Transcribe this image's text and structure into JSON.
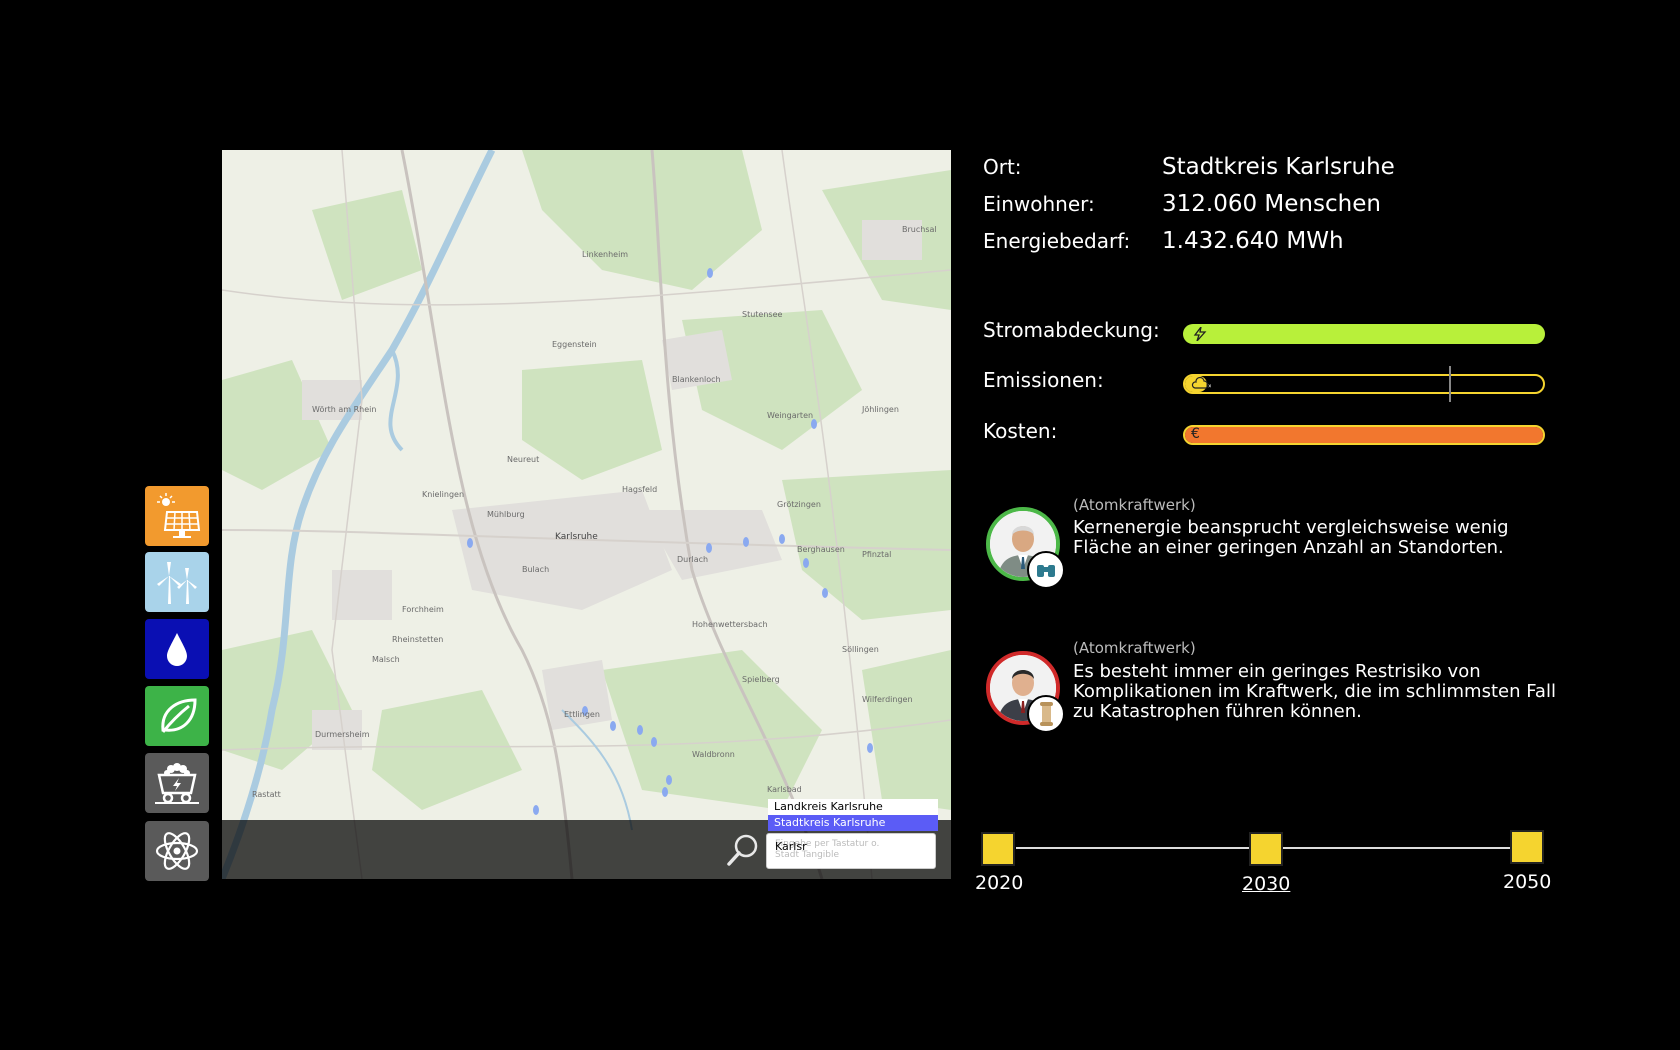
{
  "sidebar": {
    "items": [
      {
        "name": "solar",
        "icon": "solar-panel-icon",
        "color": "#f29a2e"
      },
      {
        "name": "wind",
        "icon": "wind-turbine-icon",
        "color": "#a9d3ea"
      },
      {
        "name": "water",
        "icon": "water-drop-icon",
        "color": "#0a0fb3"
      },
      {
        "name": "biomass",
        "icon": "leaf-icon",
        "color": "#3db348"
      },
      {
        "name": "coal",
        "icon": "coal-cart-icon",
        "color": "#5a5a5a"
      },
      {
        "name": "nuclear",
        "icon": "atom-icon",
        "color": "#5a5a5a"
      }
    ]
  },
  "map": {
    "labels": [
      "Karlsruhe",
      "Blankenloch",
      "Weingarten",
      "Ettlingen",
      "Durmersheim",
      "Rheinstetten",
      "Forchheim",
      "Bruchsal",
      "Linkenheim",
      "Stutensee",
      "Wörth am Rhein",
      "Durlach",
      "Grötzingen",
      "Berghausen",
      "Spielberg",
      "Malsch",
      "Rastatt",
      "Hagsfeld",
      "Eggenstein",
      "Neureut",
      "Bulach",
      "Mühlburg",
      "Knielingen",
      "Waldbronn",
      "Karlsbad",
      "Pfinztal",
      "Söllingen",
      "Jöhlingen",
      "Wilferdingen",
      "Hohenwettersbach"
    ]
  },
  "search": {
    "options": [
      "Landkreis Karlsruhe",
      "Stadtkreis Karlsruhe"
    ],
    "selected_index": 1,
    "value": "Karlsr",
    "hint_line1": "Eingabe per Tastatur o.",
    "hint_line2": "Stadt Tangible"
  },
  "info": {
    "ort_label": "Ort:",
    "ort_value": "Stadtkreis Karlsruhe",
    "einwohner_label": "Einwohner:",
    "einwohner_value": "312.060 Menschen",
    "energie_label": "Energiebedarf:",
    "energie_value": "1.432.640 MWh"
  },
  "bars": {
    "strom_label": "Stromabdeckung:",
    "strom_fill": 1.0,
    "strom_color": "#b8f03a",
    "strom_icon": "lightning-icon",
    "emission_label": "Emissionen:",
    "emission_fill": 0.06,
    "emission_marker": 0.73,
    "emission_color": "#f5d42f",
    "emission_icon": "cloud-icon",
    "kosten_label": "Kosten:",
    "kosten_fill": 1.0,
    "kosten_color": "#f2772e",
    "kosten_icon": "€"
  },
  "quotes": [
    {
      "source": "(Atomkraftwerk)",
      "text": "Kernenergie beansprucht vergleichsweise wenig Fläche an einer geringen Anzahl an Standorten.",
      "ring": "#4cb848"
    },
    {
      "source": "(Atomkraftwerk)",
      "text": "Es besteht immer ein geringes Restrisiko von Komplikationen im Kraftwerk, die im schlimmsten Fall zu Katastrophen führen können.",
      "ring": "#d02a2a"
    }
  ],
  "timeline": {
    "years": [
      "2020",
      "2030",
      "2050"
    ],
    "selected": "2030"
  }
}
